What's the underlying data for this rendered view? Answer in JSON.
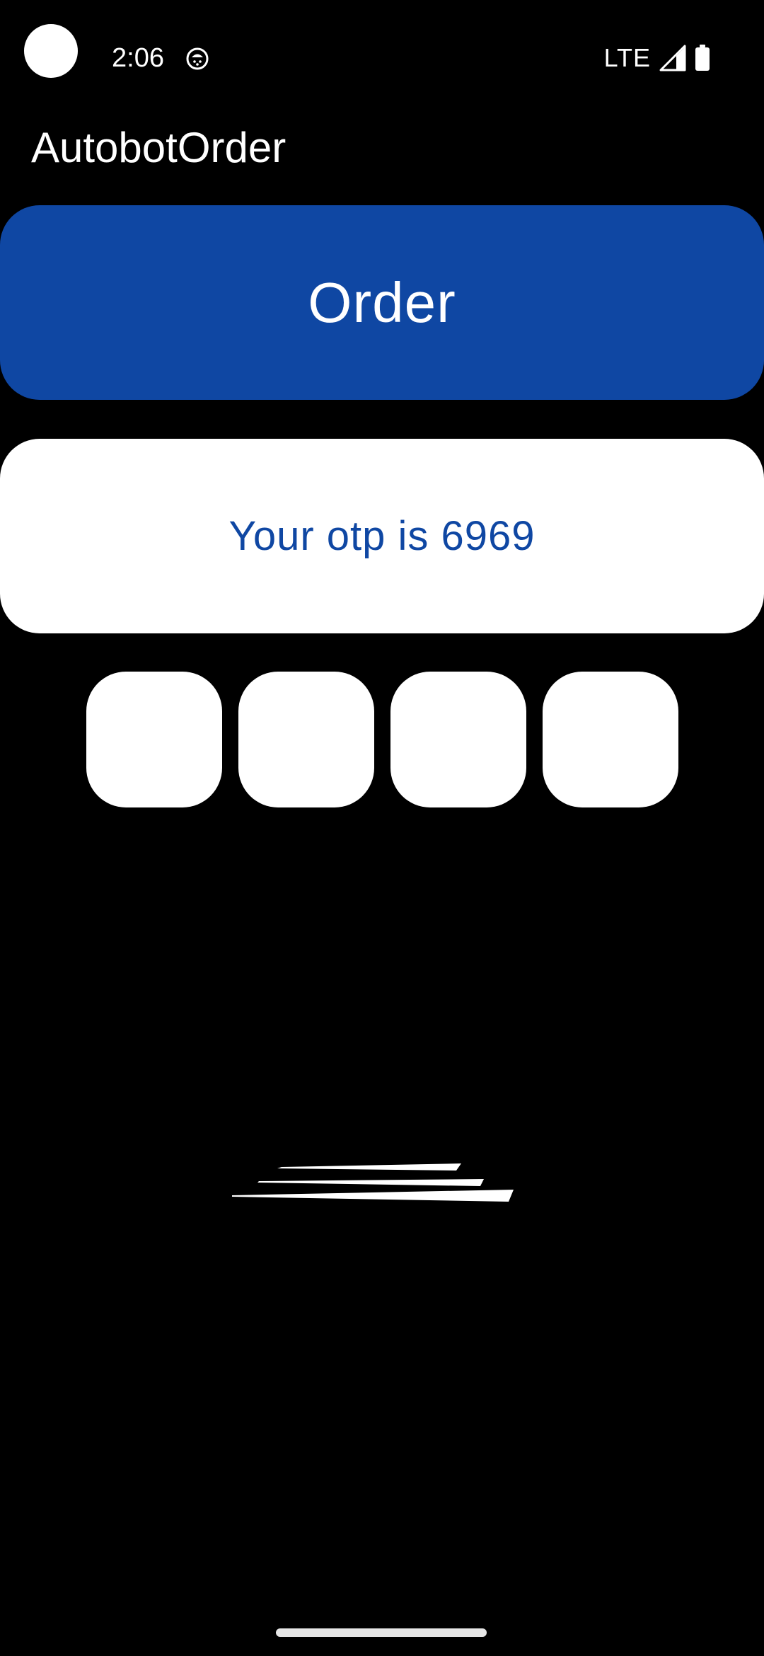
{
  "status_bar": {
    "time": "2:06",
    "network": "LTE",
    "notification_icon": "android-debug-icon",
    "signal_icon": "signal-icon",
    "battery_icon": "battery-icon"
  },
  "app_bar": {
    "title": "AutobotOrder"
  },
  "order_button": {
    "label": "Order"
  },
  "otp_message": {
    "text": "Your otp is 6969"
  },
  "otp_inputs": [
    {
      "value": ""
    },
    {
      "value": ""
    },
    {
      "value": ""
    },
    {
      "value": ""
    }
  ],
  "colors": {
    "background": "#000000",
    "accent": "#0f47a3",
    "card": "#ffffff"
  }
}
